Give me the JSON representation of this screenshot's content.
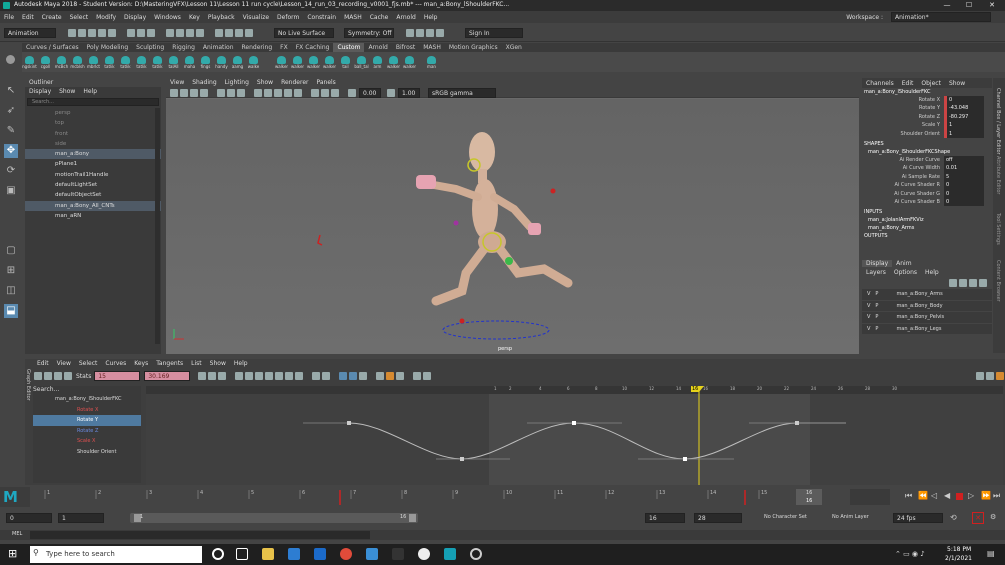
{
  "app": {
    "title": "Autodesk Maya 2018 - Student Version: D:\\MasteringVFX\\Lesson 11\\Lesson 11 run cycle\\Lesson_14_run_03_recording_v0001_fjs.mb* --- man_a:Bony_lShoulderFKC...",
    "min": "—",
    "max": "☐",
    "close": "✕"
  },
  "menus": [
    "File",
    "Edit",
    "Create",
    "Select",
    "Modify",
    "Display",
    "Windows",
    "Key",
    "Playback",
    "Visualize",
    "Deform",
    "Constrain",
    "MASH",
    "Cache",
    "Arnold",
    "Help"
  ],
  "workspace": {
    "label": "Workspace :",
    "value": "Animation*"
  },
  "status": {
    "mode": "Animation",
    "live_surface": "No Live Surface",
    "symmetry": "Symmetry: Off",
    "signin": "Sign In"
  },
  "shelf_tabs": [
    "Curves / Surfaces",
    "Poly Modeling",
    "Sculpting",
    "Rigging",
    "Animation",
    "Rendering",
    "FX",
    "FX Caching",
    "Custom",
    "Arnold",
    "Bifrost",
    "MASH",
    "Motion Graphics",
    "XGen"
  ],
  "shelf_active": "Custom",
  "shelf_items": [
    "ngskint",
    "cgoll",
    "mcBch",
    "mcblsh",
    "mbrlct",
    "tatlik",
    "tatlik",
    "tatlik",
    "tatlik",
    "talAll",
    "maha",
    "fings",
    "handy",
    "aamg",
    "walke",
    "walker",
    "walker",
    "walker",
    "walker",
    "tail",
    "ball_tal",
    "arm",
    "walker",
    "walker",
    "man"
  ],
  "outliner": {
    "title": "Outliner",
    "menu": [
      "Display",
      "Show",
      "Help"
    ],
    "search": "Search...",
    "items": [
      {
        "label": "persp",
        "dim": true
      },
      {
        "label": "top",
        "dim": true
      },
      {
        "label": "front",
        "dim": true
      },
      {
        "label": "side",
        "dim": true
      },
      {
        "label": "man_a:Bony",
        "sel": true
      },
      {
        "label": "pPlane1"
      },
      {
        "label": "motionTrail1Handle"
      },
      {
        "label": "defaultLightSet"
      },
      {
        "label": "defaultObjectSet"
      },
      {
        "label": "man_a:Bony_All_CNTs",
        "sel": true
      },
      {
        "label": "man_aRN"
      }
    ]
  },
  "viewport": {
    "menu": [
      "View",
      "Shading",
      "Lighting",
      "Show",
      "Renderer",
      "Panels"
    ],
    "exposure": "0.00",
    "gamma": "1.00",
    "colorspace": "sRGB gamma",
    "camera": "persp"
  },
  "channelbox": {
    "menu": [
      "Channels",
      "Edit",
      "Object",
      "Show"
    ],
    "object": "man_a:Bony_lShoulderFKC",
    "channels": [
      {
        "label": "Rotate X",
        "value": "0"
      },
      {
        "label": "Rotate Y",
        "value": "-43.048"
      },
      {
        "label": "Rotate Z",
        "value": "-80.297"
      },
      {
        "label": "Scale Y",
        "value": "1"
      },
      {
        "label": "Shoulder Orient",
        "value": "1"
      }
    ],
    "shapes_title": "SHAPES",
    "shape": "man_a:Bony_lShoulderFKCShape",
    "shape_attrs": [
      {
        "label": "Ai Render Curve",
        "value": "off"
      },
      {
        "label": "Ai Curve Width",
        "value": "0.01"
      },
      {
        "label": "Ai Sample Rate",
        "value": "5"
      },
      {
        "label": "Ai Curve Shader R",
        "value": "0"
      },
      {
        "label": "Ai Curve Shader G",
        "value": "0"
      },
      {
        "label": "Ai Curve Shader B",
        "value": "0"
      }
    ],
    "inputs_title": "INPUTS",
    "inputs": [
      "man_a:JolanlArmFKViz",
      "man_a:Bony_Arms"
    ],
    "outputs_title": "OUTPUTS"
  },
  "layers": {
    "tabs": [
      "Display",
      "Anim"
    ],
    "menu": [
      "Layers",
      "Options",
      "Help"
    ],
    "rows": [
      {
        "v": "V",
        "p": "P",
        "name": "man_a:Bony_Arms"
      },
      {
        "v": "V",
        "p": "P",
        "name": "man_a:Bony_Body"
      },
      {
        "v": "V",
        "p": "P",
        "name": "man_a:Bony_Pelvis"
      },
      {
        "v": "V",
        "p": "P",
        "name": "man_a:Bony_Legs"
      }
    ]
  },
  "side_tabs": [
    "Channel Box / Layer Editor",
    "Attribute Editor",
    "Tool Settings",
    "Content Browser"
  ],
  "grapheditor": {
    "title": "Graph Editor",
    "menu": [
      "Edit",
      "View",
      "Select",
      "Curves",
      "Keys",
      "Tangents",
      "List",
      "Show",
      "Help"
    ],
    "stats": "Stats",
    "stat1": "15",
    "stat2": "30.169",
    "search": "Search...",
    "items": [
      {
        "label": "man_a:Bony_lShoulderFKC",
        "color": "#ddd"
      },
      {
        "label": "Rotate X",
        "color": "#e05050"
      },
      {
        "label": "Rotate Y",
        "color": "#ffffff",
        "sel": true
      },
      {
        "label": "Rotate Z",
        "color": "#6a8ae0"
      },
      {
        "label": "Scale X",
        "color": "#e05050"
      },
      {
        "label": "Shoulder Orient",
        "color": "#ddd"
      }
    ],
    "ruler": [
      "1",
      "2",
      "4",
      "6",
      "8",
      "10",
      "12",
      "14",
      "16",
      "18",
      "20",
      "22",
      "24",
      "26",
      "28",
      "30"
    ],
    "current": "16"
  },
  "timeline": {
    "ticks": [
      "1",
      "2",
      "3",
      "4",
      "5",
      "6",
      "7",
      "8",
      "9",
      "10",
      "11",
      "12",
      "13",
      "14",
      "15",
      "16"
    ],
    "current": "16"
  },
  "range": {
    "start": "0",
    "playstart": "1",
    "slider_start": "1",
    "slider_end": "16",
    "playend": "16",
    "end": "28",
    "character": "No Character Set",
    "animlayer": "No Anim Layer",
    "fps": "24 fps"
  },
  "mel": {
    "label": "MEL"
  },
  "taskbar": {
    "search": "Type here to search",
    "time": "5:18 PM",
    "date": "2/1/2021"
  }
}
